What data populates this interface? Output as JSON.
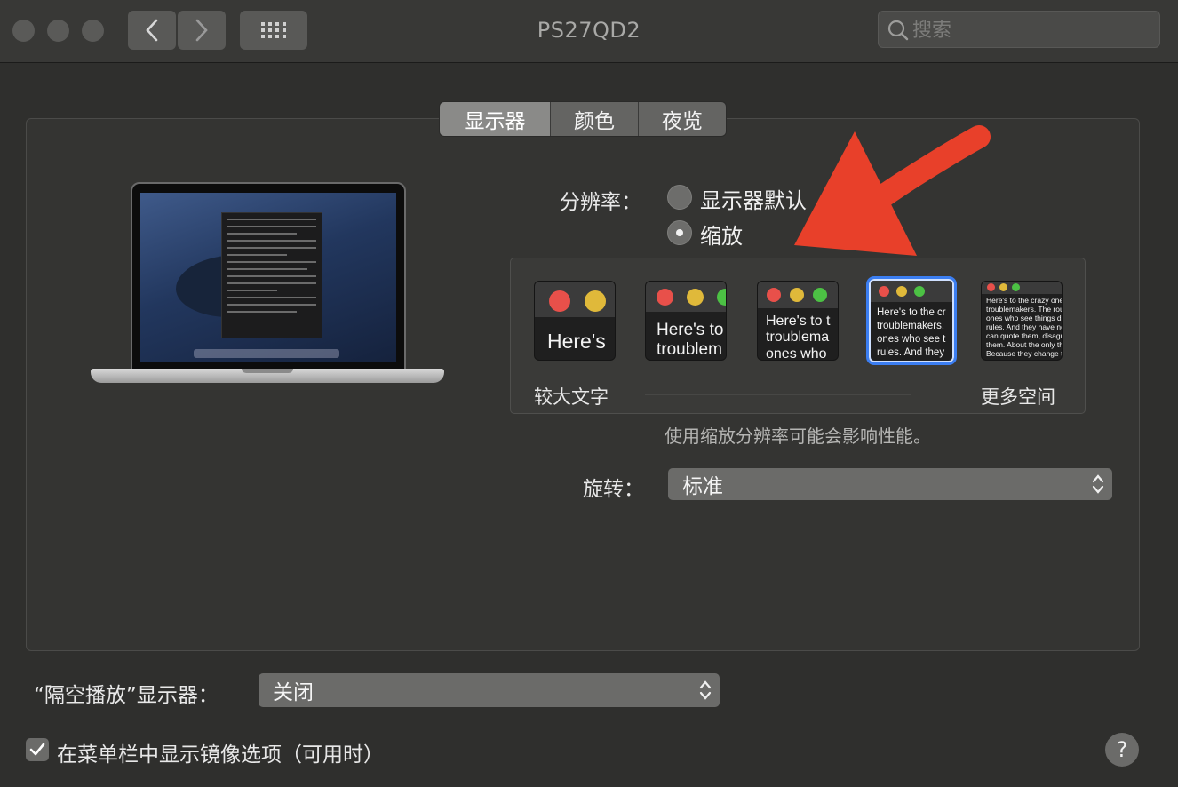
{
  "window": {
    "title": "PS27QD2"
  },
  "toolbar": {
    "search_placeholder": "搜索",
    "back_icon": "chevron-left-icon",
    "forward_icon": "chevron-right-icon",
    "grid_icon": "grid-icon"
  },
  "tabs": [
    {
      "label": "显示器",
      "active": true
    },
    {
      "label": "颜色",
      "active": false
    },
    {
      "label": "夜览",
      "active": false
    }
  ],
  "resolution": {
    "label": "分辨率：",
    "options": [
      {
        "label": "显示器默认",
        "selected": false
      },
      {
        "label": "缩放",
        "selected": true
      }
    ]
  },
  "scaling": {
    "left_label": "较大文字",
    "right_label": "更多空间",
    "selected_index": 3,
    "thumbnails": [
      {
        "text": "Here's"
      },
      {
        "text": "Here's to\ntroublem"
      },
      {
        "text": "Here's to t\ntroublema\nones who"
      },
      {
        "text": "Here's to the cr\ntroublemakers.\nones who see t\nrules. And they"
      },
      {
        "text": "Here's to the crazy one\ntroublemakers. The rou\nones who see things dif\nrules. And they have no\ncan quote them, disagre\nthem. About the only th\nBecause they change th"
      }
    ],
    "note": "使用缩放分辨率可能会影响性能。"
  },
  "rotation": {
    "label": "旋转：",
    "value": "标准"
  },
  "airplay": {
    "label": "“隔空播放”显示器：",
    "value": "关闭"
  },
  "mirror_option": {
    "label": "在菜单栏中显示镜像选项（可用时）",
    "checked": true
  },
  "help": {
    "label": "?"
  },
  "colors": {
    "accent": "#3b7ef2",
    "annotation_arrow": "#e8402a",
    "traffic_red": "#e8504a",
    "traffic_yellow": "#e0b93a",
    "traffic_green": "#4cc144"
  }
}
